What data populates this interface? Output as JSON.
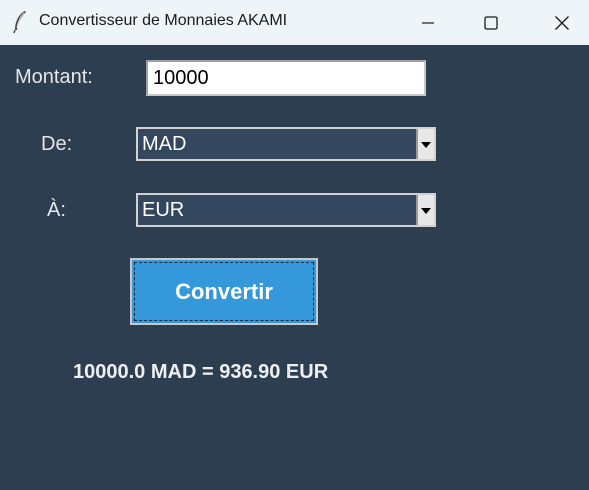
{
  "window": {
    "title": "Convertisseur de Monnaies AKAMI"
  },
  "form": {
    "amount_label": "Montant:",
    "amount_value": "10000",
    "from_label": "De:",
    "from_value": "MAD",
    "to_label": "À:",
    "to_value": "EUR",
    "convert_label": "Convertir"
  },
  "result": {
    "text": "10000.0 MAD = 936.90 EUR"
  },
  "colors": {
    "background": "#2e3e51",
    "button": "#3498db",
    "titlebar": "#eef5f9"
  }
}
